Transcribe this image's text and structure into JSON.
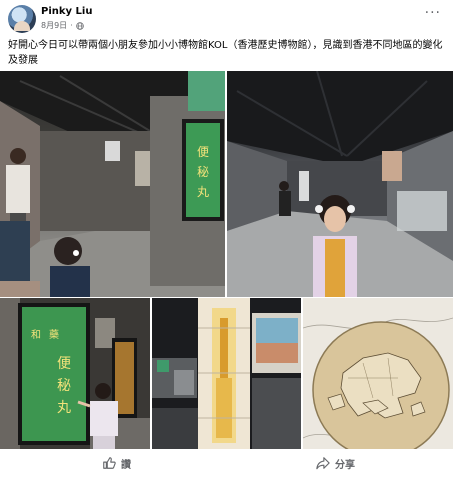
{
  "post": {
    "author": "Pinky Liu",
    "date": "8月9日",
    "separator": "·",
    "caption": "好開心今日可以帶兩個小朋友參加小小博物館KOL（香港歷史博物館），見識到香港不同地區的變化及發展"
  },
  "photos": [
    {
      "name": "photo-museum-hall-children",
      "sign_text": "便秘丸"
    },
    {
      "name": "photo-girl-in-corridor",
      "sign_text": ""
    },
    {
      "name": "photo-girl-at-sign",
      "sign_text": "便秘丸"
    },
    {
      "name": "photo-lit-display-tower",
      "sign_text": ""
    },
    {
      "name": "photo-hong-kong-map",
      "sign_text": ""
    }
  ],
  "actions": {
    "like_label": "讚",
    "share_label": "分享"
  },
  "icons": {
    "globe": "globe-icon",
    "more": "more-options-icon",
    "like": "thumbs-up-icon",
    "share": "share-arrow-icon"
  },
  "colors": {
    "text": "#050505",
    "secondary_text": "#65676b",
    "background": "#ffffff"
  }
}
